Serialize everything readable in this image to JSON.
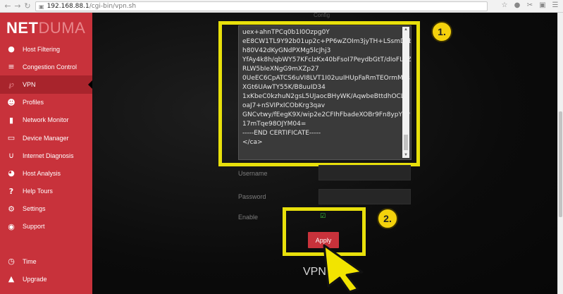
{
  "browser": {
    "url_host": "192.168.88.1",
    "url_path": "/cgi-bin/vpn.sh"
  },
  "logo": {
    "part1": "NET",
    "part2": "DUMA"
  },
  "sidebar": {
    "items": [
      {
        "label": "Host Filtering",
        "icon": "globe-icon"
      },
      {
        "label": "Congestion Control",
        "icon": "sliders-icon"
      },
      {
        "label": "VPN",
        "icon": "vpn-icon"
      },
      {
        "label": "Profiles",
        "icon": "users-icon"
      },
      {
        "label": "Network Monitor",
        "icon": "bar-chart-icon"
      },
      {
        "label": "Device Manager",
        "icon": "devices-icon"
      },
      {
        "label": "Internet Diagnosis",
        "icon": "stethoscope-icon"
      },
      {
        "label": "Host Analysis",
        "icon": "dashboard-icon"
      },
      {
        "label": "Help Tours",
        "icon": "question-icon"
      },
      {
        "label": "Settings",
        "icon": "gear-icon"
      },
      {
        "label": "Support",
        "icon": "lifebuoy-icon"
      }
    ],
    "bottom_items": [
      {
        "label": "Time",
        "icon": "clock-icon"
      },
      {
        "label": "Upgrade",
        "icon": "upload-icon"
      }
    ]
  },
  "form": {
    "config_label": "Config",
    "cert_text": "uex+ahnTPCq0b1I0Ozpg0Y\neE8CW1TL9Y92b01up2c+PP6wZOIm3jyTH+LSsmDFb\nh80V42dKyGNdPXMg5lcJhj3\nYfAy4k8h/qbWY57KFclzKx40bFsoI7PeydbGtT/dIoFLSZ\nRLW5bIeXNgG9mXZp27\n0UeEC6CpATCS6uVI8LVT1I02uuIHUpFaRmTEOrmMxs\nXGt6UAwTY55K/B8uuID34\n1xKbeC0kzhuN2gsL5UJaocBHyWK/AqwbeBttdhOCLw\noaJ7+nSVIPxICObKrg3qav\nGNCvtwy/fEegK9X/wip2e2CFIhFbadeXOBr9Fn8ypYPP\n17mTqe98OJYM04=\n-----END CERTIFICATE-----\n</ca>",
    "username_label": "Username",
    "password_label": "Password",
    "enable_label": "Enable",
    "apply_label": "Apply",
    "section_heading": "VPN"
  },
  "callouts": {
    "one": "1.",
    "two": "2."
  },
  "colors": {
    "sidebar_red": "#c8323b",
    "active_red": "#a8242c",
    "highlight_yellow": "#e8e00b",
    "callout_yellow": "#f4d20c"
  }
}
